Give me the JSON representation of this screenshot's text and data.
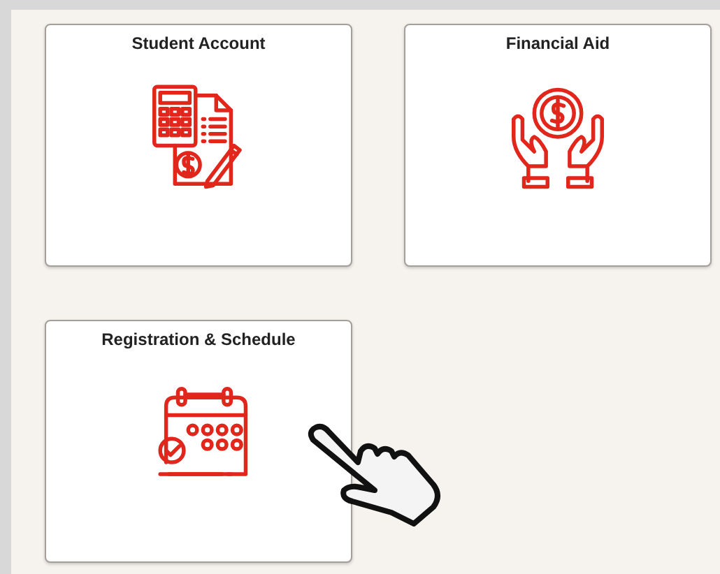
{
  "tiles": [
    {
      "title": "Student Account",
      "kind": "account"
    },
    {
      "title": "Financial Aid",
      "kind": "aid"
    },
    {
      "title": "Registration & Schedule",
      "kind": "calendar"
    }
  ]
}
